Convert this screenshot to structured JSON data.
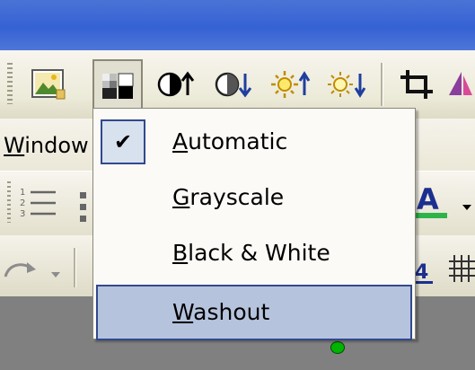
{
  "menubar": {
    "window_label": "Window",
    "window_accel": "W",
    "window_rest": "indow"
  },
  "color_menu": {
    "items": [
      {
        "accel": "A",
        "rest": "utomatic",
        "checked": true,
        "highlighted": false
      },
      {
        "accel": "G",
        "rest": "rayscale",
        "checked": false,
        "highlighted": false
      },
      {
        "accel": "B",
        "rest": "lack & White",
        "checked": false,
        "highlighted": false
      },
      {
        "accel": "W",
        "rest": "ashout",
        "checked": false,
        "highlighted": true
      }
    ],
    "check_mark": "✔"
  },
  "toolbar": {
    "buttons": [
      "insert-picture",
      "color",
      "more-contrast",
      "less-contrast",
      "more-brightness",
      "less-brightness",
      "crop",
      "line-style"
    ]
  },
  "colors": {
    "title_bar": "#3562d4",
    "highlight": "#b6c3dd",
    "highlight_border": "#31498d",
    "font_color_underline": "#22b14c"
  }
}
